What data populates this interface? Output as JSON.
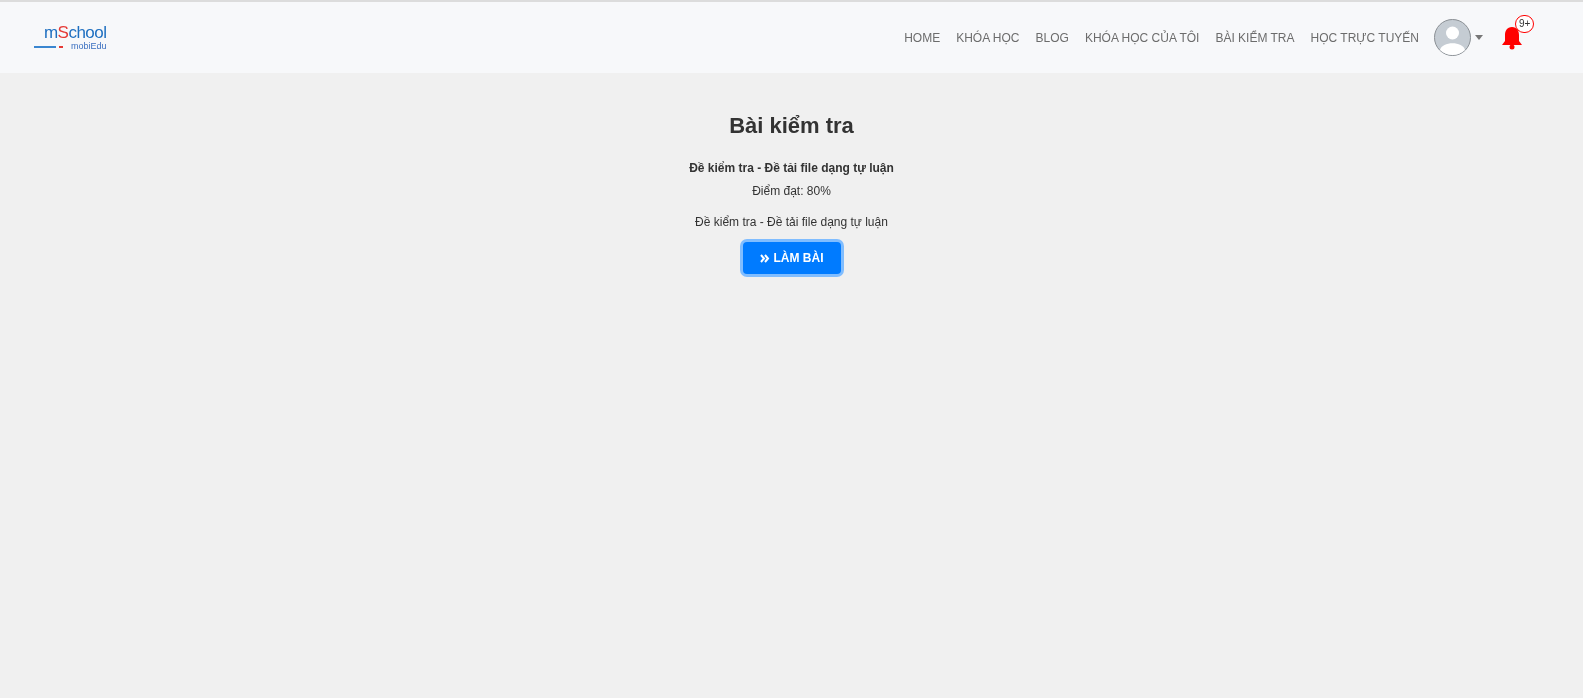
{
  "navbar": {
    "logo": {
      "name": "mSchool",
      "tagline": "mobiEdu"
    },
    "links": [
      {
        "label": "HOME"
      },
      {
        "label": "KHÓA HỌC"
      },
      {
        "label": "BLOG"
      },
      {
        "label": "KHÓA HỌC CỦA TÔI"
      },
      {
        "label": "BÀI KIỂM TRA"
      },
      {
        "label": "HỌC TRỰC TUYẾN"
      }
    ],
    "notifications": {
      "badge": "9+"
    }
  },
  "main": {
    "title": "Bài kiểm tra",
    "exam_name": "Đề kiểm tra - Đề tải file dạng tự luận",
    "pass_score": "Điểm đạt: 80%",
    "description": "Đề kiểm tra - Đề tải file dạng tự luận",
    "start_button": {
      "label": "LÀM BÀI",
      "focused": true
    }
  }
}
